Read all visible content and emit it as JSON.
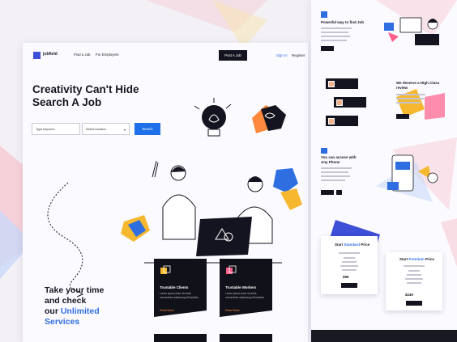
{
  "colors": {
    "accent": "#2f6ee0",
    "dark": "#141420",
    "orange": "#ff8a3d",
    "pink": "#f7c9d3",
    "yellow": "#f5b82e",
    "blue": "#3e4fd8"
  },
  "nav": {
    "logo": "jobfield",
    "links": [
      "Find a Job",
      "For Employers"
    ],
    "post_button": "Post A Job",
    "sign_in": "Sign In",
    "register": "Register"
  },
  "hero": {
    "title_line1": "Creativity Can't Hide",
    "title_line2": "Search A Job",
    "keyword_placeholder": "Type keyword",
    "location_placeholder": "Select location",
    "search_button": "Search"
  },
  "tagline": {
    "line1": "Take your time",
    "line2": "and check",
    "line3_prefix": "our ",
    "line3_highlight": "Unlimited",
    "line4": "Services"
  },
  "cards": [
    {
      "title": "Trustable Clients",
      "text": "Lorem ipsum dolor sit amet, consectetur adipiscing elit facilisis.",
      "link": "Read More"
    },
    {
      "title": "Trustable Workers",
      "text": "Lorem ipsum dolor sit amet, consectetur adipiscing elit facilisis.",
      "link": "Read More"
    }
  ],
  "right": {
    "section1_title": "Powerful way to find Job",
    "section2_title_line1": "We deserve a High Class",
    "section2_title_line2": "review",
    "section3_title_line1": "You can access with",
    "section3_title_line2": "Any Phone",
    "pricing": [
      {
        "title_prefix": "Start ",
        "title_highlight": "Standard",
        "title_suffix": " Price",
        "amount": "$99"
      },
      {
        "title_prefix": "Start ",
        "title_highlight": "Premium",
        "title_suffix": " Price",
        "amount": "$249"
      }
    ]
  }
}
